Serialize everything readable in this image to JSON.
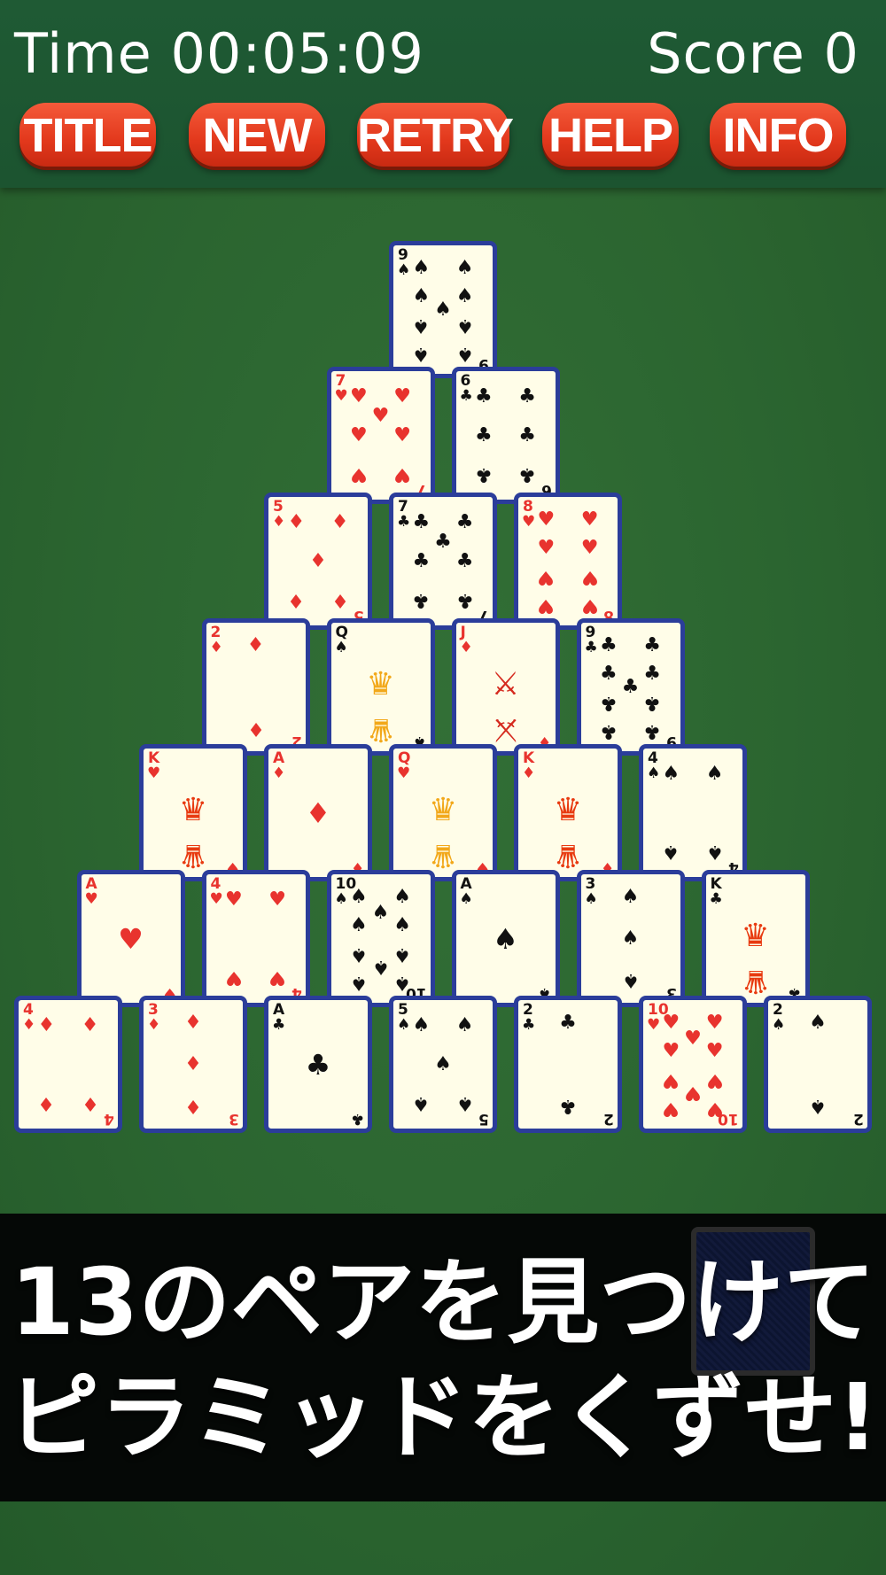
{
  "hud": {
    "time": "Time 00:05:09",
    "score": "Score 0"
  },
  "buttons": [
    {
      "id": "title",
      "label": "TITLE"
    },
    {
      "id": "new",
      "label": "NEW"
    },
    {
      "id": "retry",
      "label": "RETRY"
    },
    {
      "id": "help",
      "label": "HELP"
    },
    {
      "id": "info",
      "label": "INFO"
    }
  ],
  "pyramid": [
    [
      {
        "rank": "9",
        "suit": "spade"
      }
    ],
    [
      {
        "rank": "7",
        "suit": "heart"
      },
      {
        "rank": "6",
        "suit": "club"
      }
    ],
    [
      {
        "rank": "5",
        "suit": "diamond"
      },
      {
        "rank": "7",
        "suit": "club"
      },
      {
        "rank": "8",
        "suit": "heart"
      }
    ],
    [
      {
        "rank": "2",
        "suit": "diamond"
      },
      {
        "rank": "Q",
        "suit": "spade"
      },
      {
        "rank": "J",
        "suit": "diamond"
      },
      {
        "rank": "9",
        "suit": "club"
      }
    ],
    [
      {
        "rank": "K",
        "suit": "heart"
      },
      {
        "rank": "A",
        "suit": "diamond"
      },
      {
        "rank": "Q",
        "suit": "heart"
      },
      {
        "rank": "K",
        "suit": "diamond"
      },
      {
        "rank": "4",
        "suit": "spade"
      }
    ],
    [
      {
        "rank": "A",
        "suit": "heart"
      },
      {
        "rank": "4",
        "suit": "heart"
      },
      {
        "rank": "10",
        "suit": "spade"
      },
      {
        "rank": "A",
        "suit": "spade"
      },
      {
        "rank": "3",
        "suit": "spade"
      },
      {
        "rank": "K",
        "suit": "club"
      }
    ],
    [
      {
        "rank": "4",
        "suit": "diamond"
      },
      {
        "rank": "3",
        "suit": "diamond"
      },
      {
        "rank": "A",
        "suit": "club"
      },
      {
        "rank": "5",
        "suit": "spade"
      },
      {
        "rank": "2",
        "suit": "club"
      },
      {
        "rank": "10",
        "suit": "heart"
      },
      {
        "rank": "2",
        "suit": "spade"
      }
    ]
  ],
  "stock": {
    "icon": "card-back-icon"
  },
  "banner": {
    "line1": "13のペアを見つけて",
    "line2": "ピラミッドをくずせ!"
  },
  "colors": {
    "felt": "#2a6530",
    "button": "#e2381c",
    "card_border": "#2b3d9a",
    "card_face": "#fffde8",
    "red_suit": "#e8332e"
  }
}
